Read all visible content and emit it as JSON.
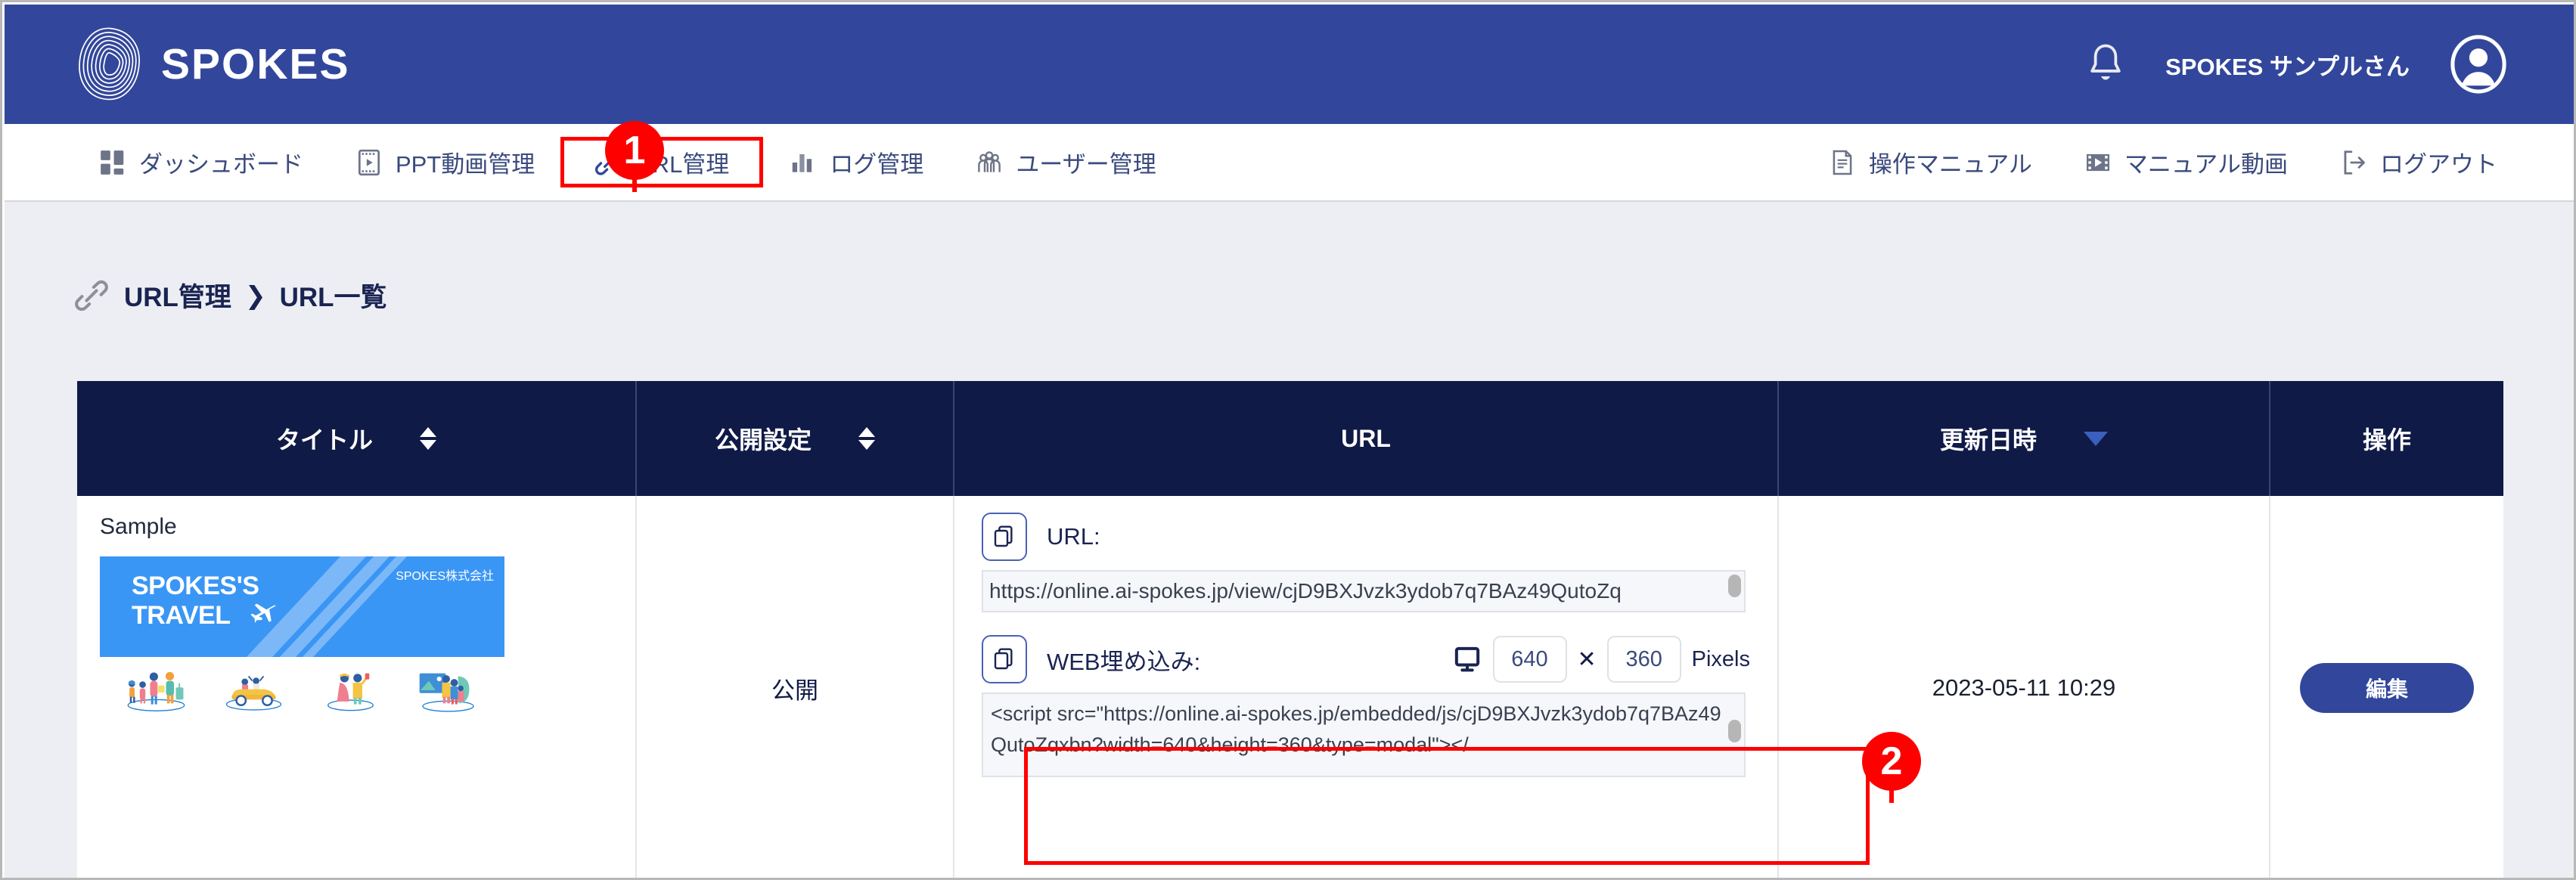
{
  "header": {
    "brand": "SPOKES",
    "brand_icon": "spokes-logo-icon",
    "bell_icon": "notification-bell-icon",
    "user_name": "SPOKES サンプルさん",
    "avatar_icon": "user-avatar-icon"
  },
  "nav": {
    "left_items": [
      {
        "label": "ダッシュボード",
        "icon": "dashboard-grid-icon",
        "active": false
      },
      {
        "label": "PPT動画管理",
        "icon": "slide-video-icon",
        "active": false
      },
      {
        "label": "URL管理",
        "icon": "link-chain-icon",
        "active": true
      },
      {
        "label": "ログ管理",
        "icon": "log-chart-icon",
        "active": false
      },
      {
        "label": "ユーザー管理",
        "icon": "users-group-icon",
        "active": false
      }
    ],
    "right_items": [
      {
        "label": "操作マニュアル",
        "icon": "document-manual-icon"
      },
      {
        "label": "マニュアル動画",
        "icon": "film-video-icon"
      },
      {
        "label": "ログアウト",
        "icon": "logout-arrow-icon"
      }
    ]
  },
  "breadcrumb": {
    "icon": "link-chain-icon",
    "root": "URL管理",
    "separator": "❯",
    "current": "URL一覧"
  },
  "table": {
    "columns": [
      {
        "label": "タイトル",
        "sortable": true,
        "sort_state": "none"
      },
      {
        "label": "公開設定",
        "sortable": true,
        "sort_state": "none"
      },
      {
        "label": "URL",
        "sortable": false,
        "sort_state": "none"
      },
      {
        "label": "更新日時",
        "sortable": true,
        "sort_state": "desc"
      },
      {
        "label": "操作",
        "sortable": false,
        "sort_state": "none"
      }
    ],
    "rows": [
      {
        "title": "Sample",
        "thumbnail": {
          "headline_line1": "SPOKES'S",
          "headline_line2": "TRAVEL",
          "corp": "SPOKES株式会社",
          "plane_icon": "airplane-icon"
        },
        "public_setting": "公開",
        "url": {
          "copy_icon": "copy-icon",
          "label": "URL:",
          "value": "https://online.ai-spokes.jp/view/cjD9BXJvzk3ydob7q7BAz49QutoZq"
        },
        "embed": {
          "copy_icon": "copy-icon",
          "label": "WEB埋め込み:",
          "monitor_icon": "monitor-icon",
          "width": "640",
          "separator": "✕",
          "height": "360",
          "unit": "Pixels",
          "value": "<script src=\"https://online.ai-spokes.jp/embedded/js/cjD9BXJvzk3ydob7q7BAz49QutoZqxbn?width=640&height=360&type=modal\"></"
        },
        "updated_at": "2023-05-11 10:29",
        "action_label": "編集"
      }
    ]
  },
  "callouts": [
    {
      "number": "1",
      "target": "URL管理 nav item"
    },
    {
      "number": "2",
      "target": "WEB埋め込み script box"
    }
  ],
  "colors": {
    "header_blue": "#32479b",
    "table_header_navy": "#101a47",
    "page_bg": "#eceef3",
    "accent_red": "#ff0000",
    "thumb_blue": "#3a96f5"
  }
}
